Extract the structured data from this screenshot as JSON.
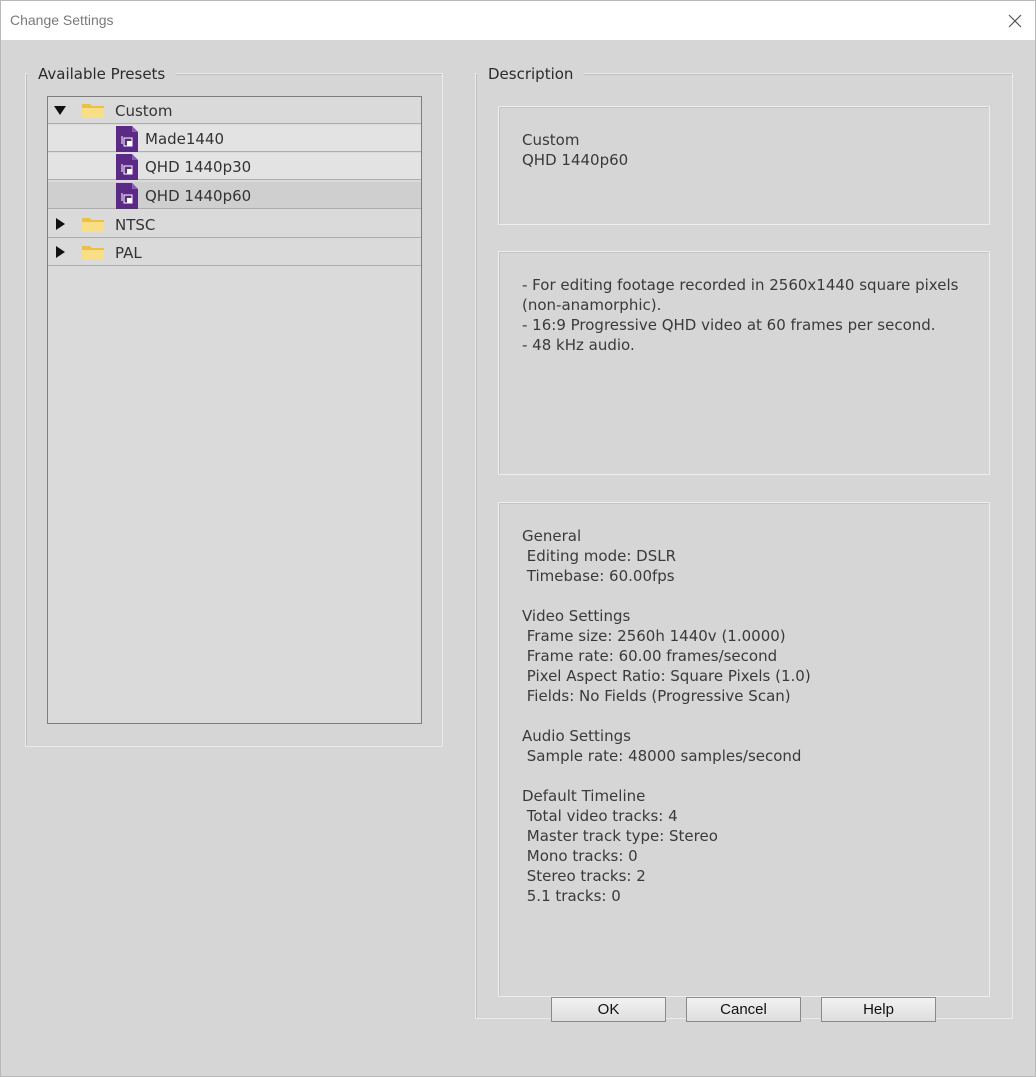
{
  "window": {
    "title": "Change Settings"
  },
  "presets": {
    "group_label": "Available Presets",
    "tree": [
      {
        "label": "Custom",
        "type": "folder",
        "expanded": true
      },
      {
        "label": "Made1440",
        "type": "preset"
      },
      {
        "label": "QHD 1440p30",
        "type": "preset"
      },
      {
        "label": "QHD 1440p60",
        "type": "preset",
        "selected": true
      },
      {
        "label": "NTSC",
        "type": "folder",
        "expanded": false
      },
      {
        "label": "PAL",
        "type": "folder",
        "expanded": false
      }
    ]
  },
  "description": {
    "group_label": "Description",
    "summary": "Custom\nQHD 1440p60",
    "details": "- For editing footage recorded in 2560x1440 square pixels\n(non-anamorphic).\n- 16:9 Progressive QHD video at 60 frames per second.\n- 48 kHz audio.",
    "settings": "General\n Editing mode: DSLR\n Timebase: 60.00fps\n\nVideo Settings\n Frame size: 2560h 1440v (1.0000)\n Frame rate: 60.00 frames/second\n Pixel Aspect Ratio: Square Pixels (1.0)\n Fields: No Fields (Progressive Scan)\n\nAudio Settings\n Sample rate: 48000 samples/second\n\nDefault Timeline\n Total video tracks: 4\n Master track type: Stereo\n Mono tracks: 0\n Stereo tracks: 2\n 5.1 tracks: 0"
  },
  "buttons": {
    "ok": "OK",
    "cancel": "Cancel",
    "help": "Help"
  },
  "icons": {
    "close": "close-icon",
    "folder": "folder-icon",
    "preset": "preset-file-icon",
    "expanded": "triangle-down-icon",
    "collapsed": "triangle-right-icon"
  },
  "colors": {
    "preset_icon": "#5b2a86",
    "folder": "#f3d36b",
    "background": "#d6d6d6"
  }
}
